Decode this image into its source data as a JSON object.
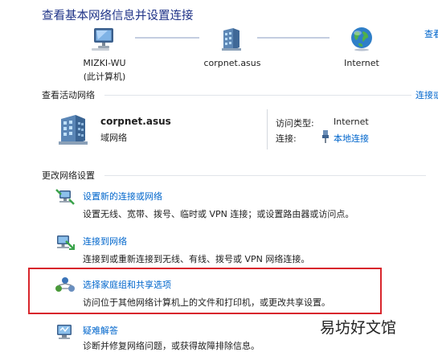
{
  "header": {
    "title": "查看基本网络信息并设置连接",
    "right_link": "查看"
  },
  "network_map": {
    "nodes": [
      {
        "label": "MIZKI-WU",
        "sublabel": "(此计算机)",
        "icon": "computer-icon"
      },
      {
        "label": "corpnet.asus",
        "sublabel": "",
        "icon": "network-building-icon"
      },
      {
        "label": "Internet",
        "sublabel": "",
        "icon": "globe-icon"
      }
    ]
  },
  "active_networks": {
    "heading": "查看活动网络",
    "right_link": "连接或",
    "network": {
      "name": "corpnet.asus",
      "category": "域网络",
      "icon": "domain-network-icon",
      "access_type_label": "访问类型:",
      "access_type_value": "Internet",
      "connections_label": "连接:",
      "connections_value": "本地连接",
      "connection_icon": "ethernet-plug-icon"
    }
  },
  "change_settings": {
    "heading": "更改网络设置",
    "tasks": [
      {
        "link": "设置新的连接或网络",
        "desc": "设置无线、宽带、拨号、临时或 VPN 连接；或设置路由器或访问点。",
        "icon": "new-connection-icon"
      },
      {
        "link": "连接到网络",
        "desc": "连接到或重新连接到无线、有线、拨号或 VPN 网络连接。",
        "icon": "connect-network-icon"
      },
      {
        "link": "选择家庭组和共享选项",
        "desc": "访问位于其他网络计算机上的文件和打印机，或更改共享设置。",
        "icon": "homegroup-icon"
      },
      {
        "link": "疑难解答",
        "desc": "诊断并修复网络问题，或获得故障排除信息。",
        "icon": "troubleshoot-icon"
      }
    ]
  },
  "watermark": "易坊好文馆",
  "colors": {
    "title": "#1e3287",
    "link": "#0066cc",
    "highlight_box": "#d8262c"
  }
}
